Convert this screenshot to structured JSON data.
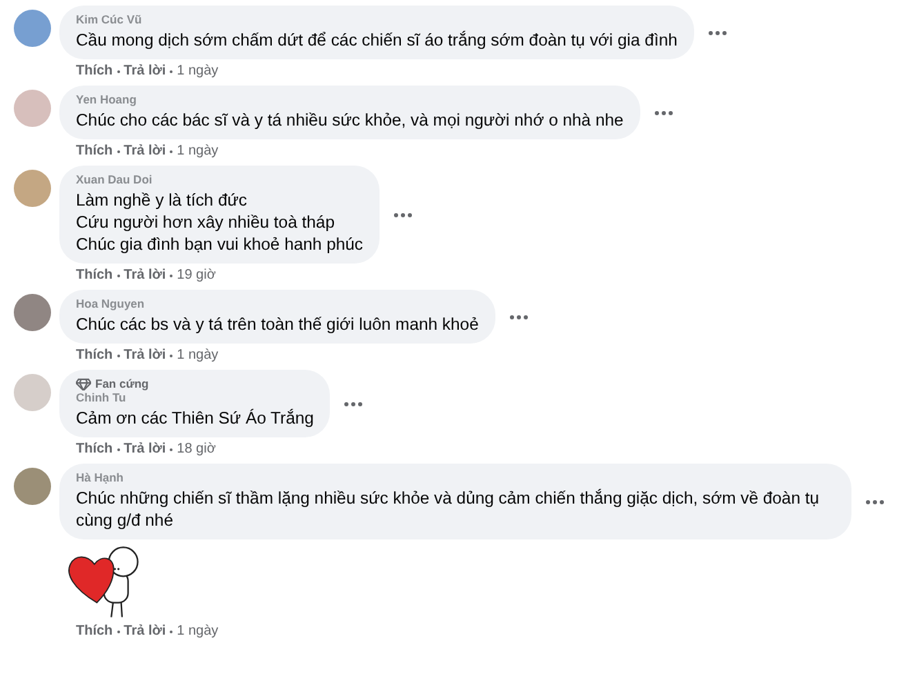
{
  "comments": [
    {
      "name": "Kim Cúc Vũ",
      "lines": [
        "Cầu mong dịch sớm chấm dứt để các chiến sĩ áo trắng sớm đoàn tụ với gia đình"
      ],
      "like": "Thích",
      "reply": "Trả lời",
      "time": "1 ngày"
    },
    {
      "name": "Yen Hoang",
      "lines": [
        "Chúc cho các bác sĩ và y tá nhiều sức khỏe, và mọi người nhớ o nhà nhe"
      ],
      "like": "Thích",
      "reply": "Trả lời",
      "time": "1 ngày"
    },
    {
      "name": "Xuan Dau Doi",
      "lines": [
        "Làm nghề y là tích đức",
        "Cứu người hơn xây nhiều toà tháp",
        "Chúc gia đình bạn vui khoẻ hanh phúc"
      ],
      "like": "Thích",
      "reply": "Trả lời",
      "time": "19 giờ"
    },
    {
      "name": "Hoa Nguyen",
      "lines": [
        "Chúc các bs và y tá trên toàn thế giới luôn manh khoẻ"
      ],
      "like": "Thích",
      "reply": "Trả lời",
      "time": "1 ngày"
    },
    {
      "badge": "Fan cứng",
      "name": "Chinh Tu",
      "lines": [
        "Cảm ơn các Thiên Sứ Áo Trắng"
      ],
      "like": "Thích",
      "reply": "Trả lời",
      "time": "18 giờ"
    },
    {
      "name": "Hà Hạnh",
      "lines": [
        "Chúc những chiến sĩ thầm lặng nhiều sức khỏe và dủng cảm chiến thắng giặc dịch, sớm về đoàn tụ cùng g/đ nhé"
      ],
      "sticker": true,
      "like": "Thích",
      "reply": "Trả lời",
      "time": "1 ngày"
    }
  ]
}
